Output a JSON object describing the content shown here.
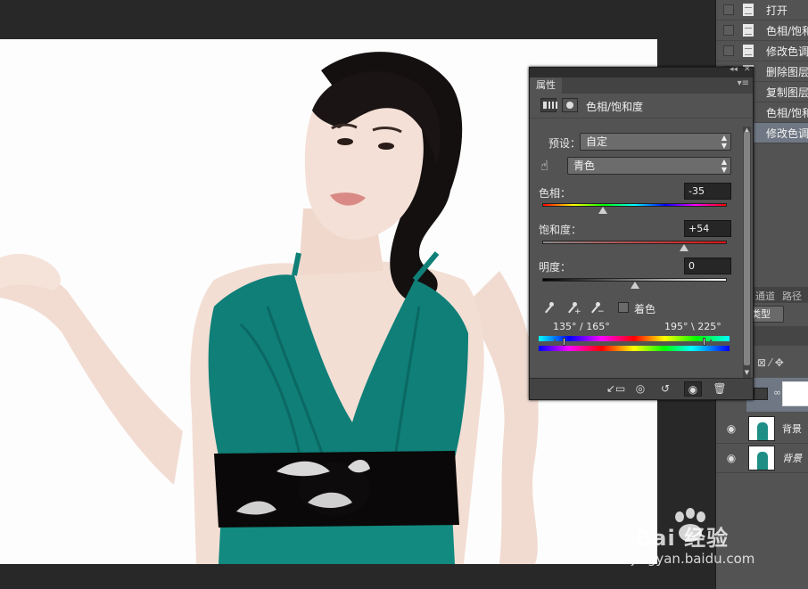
{
  "history": {
    "items": [
      {
        "label": "打开",
        "active": false
      },
      {
        "label": "色相/饱和",
        "active": false
      },
      {
        "label": "修改色调",
        "active": false
      },
      {
        "label": "删除图层",
        "active": false
      },
      {
        "label": "复制图层",
        "active": false
      },
      {
        "label": "色相/饱和",
        "active": false
      },
      {
        "label": "修改色调",
        "active": true
      }
    ]
  },
  "layers": {
    "tabs": [
      "通道",
      "路径"
    ],
    "filter_label": "类型",
    "rows": [
      {
        "name": "背景"
      },
      {
        "name": "背景"
      }
    ]
  },
  "properties": {
    "tab": "属性",
    "title": "色相/饱和度",
    "preset_label": "预设：",
    "preset_value": "自定",
    "channel_value": "青色",
    "hue_label": "色相：",
    "hue_value": "-35",
    "hue_fraction": 0.33,
    "saturation_label": "饱和度：",
    "saturation_value": "+54",
    "saturation_fraction": 0.77,
    "lightness_label": "明度：",
    "lightness_value": "0",
    "lightness_fraction": 0.5,
    "colorize_label": "着色",
    "colorize_checked": false,
    "range_left": "135° / 165°",
    "range_right": "195° \\ 225°"
  },
  "watermark": {
    "brand": "Bai  经验",
    "url": "jingyan.baidu.com"
  },
  "colors": {
    "dress_teal": "#0f7f78",
    "panel_bg": "#535353",
    "history_active": "#6f7784"
  }
}
